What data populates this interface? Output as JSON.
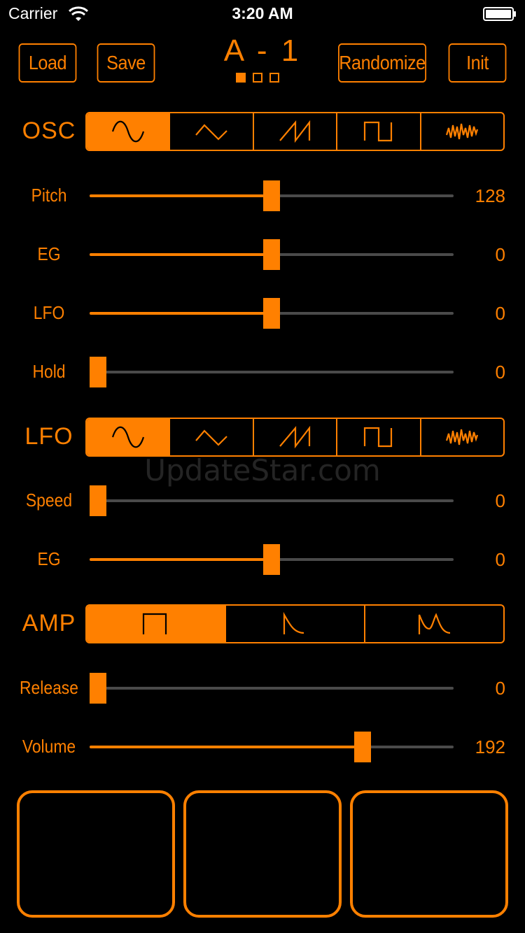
{
  "statusbar": {
    "carrier": "Carrier",
    "time": "3:20 AM",
    "wifi_icon": "wifi-icon",
    "battery_icon": "battery-icon"
  },
  "colors": {
    "accent": "#ff8000",
    "background": "#000000",
    "track": "#4a4a4a"
  },
  "toolbar": {
    "load": "Load",
    "save": "Save",
    "randomize": "Randomize",
    "init": "Init"
  },
  "preset": {
    "name": "A - 1",
    "pages": [
      true,
      false,
      false
    ]
  },
  "osc": {
    "label": "OSC",
    "waveforms": [
      "sine-wave-icon",
      "triangle-wave-icon",
      "sawtooth-wave-icon",
      "square-wave-icon",
      "noise-wave-icon"
    ],
    "selected": 0,
    "params": [
      {
        "label": "Pitch",
        "value": "128",
        "level": 0.5
      },
      {
        "label": "EG",
        "value": "0",
        "level": 0.5
      },
      {
        "label": "LFO",
        "value": "0",
        "level": 0.5
      },
      {
        "label": "Hold",
        "value": "0",
        "level": 0.0
      }
    ]
  },
  "lfo": {
    "label": "LFO",
    "waveforms": [
      "sine-wave-icon",
      "triangle-wave-icon",
      "sawtooth-wave-icon",
      "square-wave-icon",
      "noise-wave-icon"
    ],
    "selected": 0,
    "params": [
      {
        "label": "Speed",
        "value": "0",
        "level": 0.0
      },
      {
        "label": "EG",
        "value": "0",
        "level": 0.5
      }
    ]
  },
  "amp": {
    "label": "AMP",
    "envelopes": [
      "gate-envelope-icon",
      "decay-envelope-icon",
      "attack-decay-envelope-icon"
    ],
    "selected": 0,
    "params": [
      {
        "label": "Release",
        "value": "0",
        "level": 0.0
      },
      {
        "label": "Volume",
        "value": "192",
        "level": 0.75
      }
    ]
  },
  "watermark": "UpdateStar.com",
  "pads": [
    "pad-1",
    "pad-2",
    "pad-3"
  ]
}
